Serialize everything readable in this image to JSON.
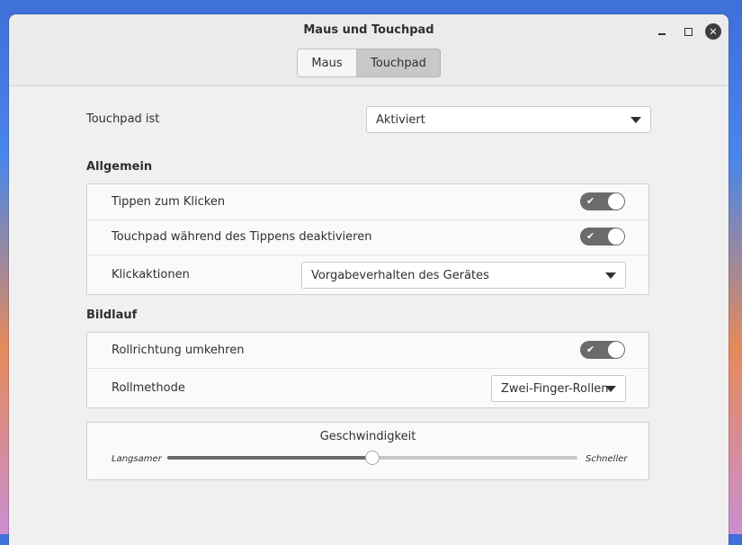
{
  "window": {
    "title": "Maus und Touchpad",
    "controls": {
      "minimize": "minimize-icon",
      "maximize": "maximize-icon",
      "close": "close-icon"
    }
  },
  "tabs": [
    {
      "label": "Maus",
      "active": false
    },
    {
      "label": "Touchpad",
      "active": true
    }
  ],
  "touchpad_state": {
    "label": "Touchpad ist",
    "value": "Aktiviert"
  },
  "general": {
    "title": "Allgemein",
    "tap_to_click": {
      "label": "Tippen zum Klicken",
      "enabled": true
    },
    "disable_while_typing": {
      "label": "Touchpad während des Tippens deaktivieren",
      "enabled": true
    },
    "click_actions": {
      "label": "Klickaktionen",
      "value": "Vorgabeverhalten des Gerätes"
    }
  },
  "scrolling": {
    "title": "Bildlauf",
    "reverse": {
      "label": "Rollrichtung umkehren",
      "enabled": true
    },
    "method": {
      "label": "Rollmethode",
      "value": "Zwei-Finger-Rollen"
    }
  },
  "speed": {
    "title": "Geschwindigkeit",
    "min_label": "Langsamer",
    "max_label": "Schneller",
    "value_fraction": 0.5
  },
  "colors": {
    "switch_on": "#6b6b6b",
    "slider_fill": "#6b6b6b",
    "slider_rest": "#c6c6c6"
  }
}
